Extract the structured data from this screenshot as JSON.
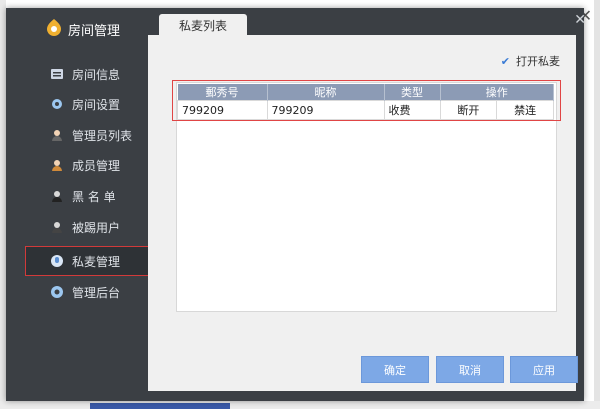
{
  "app": {
    "title": "房间管理"
  },
  "tab": {
    "label": "私麦列表"
  },
  "sidebar": {
    "items": [
      {
        "label": "房间信息",
        "icon": "list-icon"
      },
      {
        "label": "房间设置",
        "icon": "gear-icon"
      },
      {
        "label": "管理员列表",
        "icon": "admin-user-icon"
      },
      {
        "label": "成员管理",
        "icon": "member-icon"
      },
      {
        "label": "黑 名 单",
        "icon": "blacklist-user-icon"
      },
      {
        "label": "被踢用户",
        "icon": "kicked-user-icon"
      },
      {
        "label": "私麦管理",
        "icon": "private-mic-icon"
      },
      {
        "label": "管理后台",
        "icon": "backend-icon"
      }
    ]
  },
  "options": {
    "open_private_mic": "打开私麦",
    "open_private_mic_checked": true
  },
  "table": {
    "headers": [
      "郵秀号",
      "昵称",
      "类型",
      "操作"
    ],
    "rows": [
      {
        "id": "799209",
        "nickname": "799209",
        "type": "收费",
        "action1": "断开",
        "action2": "禁连"
      }
    ]
  },
  "buttons": {
    "confirm": "确定",
    "cancel": "取消",
    "apply": "应用"
  },
  "colors": {
    "accent": "#7da8e6",
    "highlight_border": "#e04545",
    "sidebar_bg": "#3b3f44"
  }
}
